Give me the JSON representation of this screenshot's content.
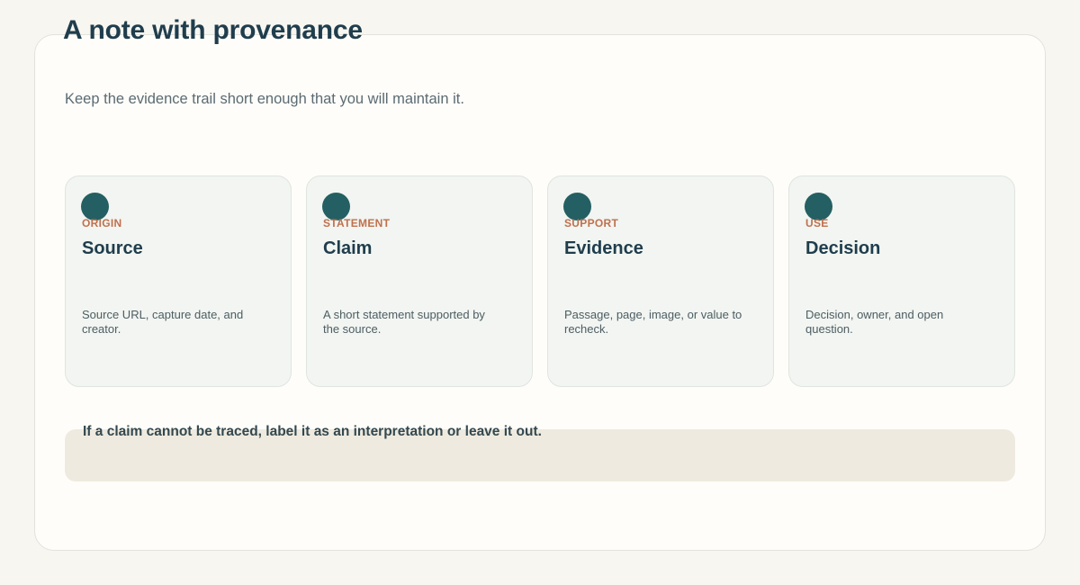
{
  "header": {
    "title": "A note with provenance",
    "subtitle": "Keep the evidence trail short enough that you will maintain it."
  },
  "cards": [
    {
      "kicker": "ORIGIN",
      "title": "Source",
      "description": "Source URL, capture date, and creator."
    },
    {
      "kicker": "STATEMENT",
      "title": "Claim",
      "description": "A short statement supported by the source."
    },
    {
      "kicker": "SUPPORT",
      "title": "Evidence",
      "description": "Passage, page, image, or value to recheck."
    },
    {
      "kicker": "USE",
      "title": "Decision",
      "description": "Decision, owner, and open question."
    }
  ],
  "note": {
    "text": "If a claim cannot be traced, label it as an interpretation or leave it out."
  },
  "colors": {
    "page_background": "#f8f6f0",
    "panel_background": "#fefdf9",
    "title": "#1f3d4d",
    "accent_dot": "#245f63",
    "kicker": "#c0704e",
    "card_background": "#f2f5f1",
    "note_background": "#efeadf"
  }
}
